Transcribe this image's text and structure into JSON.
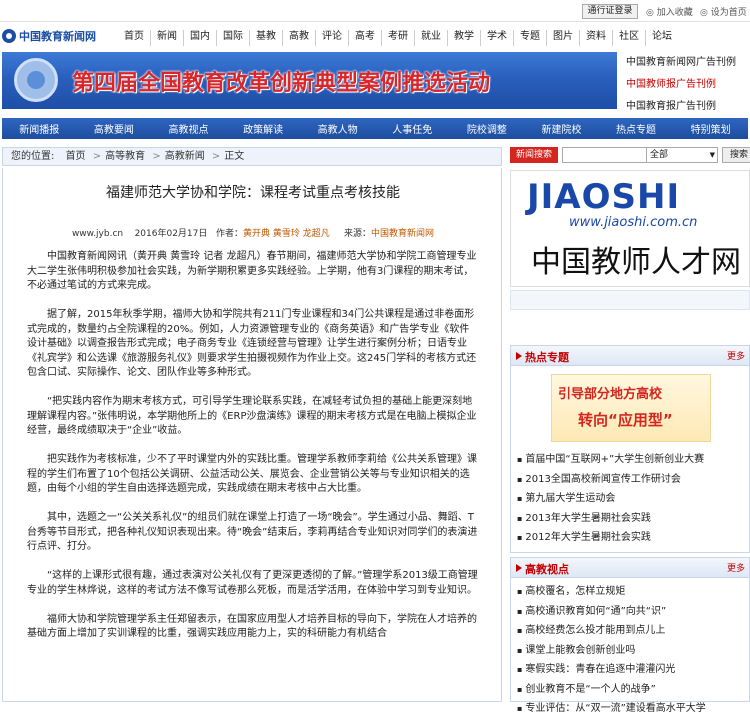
{
  "topbar": {
    "login": "通行证登录",
    "fav": "加入收藏",
    "home": "设为首页"
  },
  "logo": {
    "text": "中国教育新闻网"
  },
  "nav": [
    "首页",
    "新闻",
    "国内",
    "国际",
    "基教",
    "高教",
    "评论",
    "高考",
    "考研",
    "就业",
    "教学",
    "学术",
    "专题",
    "图片",
    "资料",
    "社区",
    "论坛"
  ],
  "banner": {
    "title": "第四届全国教育改革创新典型案例推选活动"
  },
  "adlinks": [
    "中国教育新闻网广告刊例",
    "中国教师报广告刊例",
    "中国教育报广告刊例"
  ],
  "subnav": [
    "新闻播报",
    "高教要闻",
    "高教视点",
    "政策解读",
    "高教人物",
    "人事任免",
    "院校调整",
    "新建院校",
    "热点专题",
    "特别策划"
  ],
  "breadcrumb": {
    "label": "您的位置:",
    "items": [
      "首页",
      "高等教育",
      "高教新闻",
      "正文"
    ]
  },
  "search": {
    "tag": "新闻搜索",
    "select": "全部",
    "button": "搜索"
  },
  "article": {
    "title": "福建师范大学协和学院：课程考试重点考核技能",
    "site": "www.jyb.cn",
    "date": "2016年02月17日",
    "author_label": "作者：",
    "author": "黄开典 黄雪玲 龙超凡",
    "source_label": "来源：",
    "source": "中国教育新闻网",
    "paragraphs": [
      "中国教育新闻网讯（黄开典 黄雪玲 记者 龙超凡）春节期间，福建师范大学协和学院工商管理专业大二学生张伟明积极参加社会实践，为新学期积累更多实践经验。上学期，他有3门课程的期末考试，不必通过笔试的方式来完成。",
      "据了解，2015年秋季学期，福师大协和学院共有211门专业课程和34门公共课程是通过非卷面形式完成的，数量约占全院课程的20%。例如，人力资源管理专业的《商务英语》和广告学专业《软件设计基础》以调查报告形式完成；电子商务专业《连锁经营与管理》让学生进行案例分析；日语专业《礼宾学》和公选课《旅游服务礼仪》则要求学生拍摄视频作为作业上交。这245门学科的考核方式还包含口试、实际操作、论文、团队作业等多种形式。",
      "“把实践内容作为期末考核方式，可引导学生理论联系实践，在减轻考试负担的基础上能更深刻地理解课程内容。”张伟明说，本学期他所上的《ERP沙盘演练》课程的期末考核方式是在电脑上模拟企业经营，最终成绩取决于“企业”收益。",
      "把实践作为考核标准，少不了平时课堂内外的实践比重。管理学系教师李莉给《公共关系管理》课程的学生们布置了10个包括公关调研、公益活动公关、展览会、企业营销公关等与专业知识相关的选题，由每个小组的学生自由选择选题完成，实践成绩在期末考核中占大比重。",
      "其中，选题之一“公关关系礼仪”的组员们就在课堂上打造了一场“晚会”。学生通过小品、舞蹈、T台秀等节目形式，把各种礼仪知识表现出来。待“晚会”结束后，李莉再结合专业知识对同学们的表演进行点评、打分。",
      "“这样的上课形式很有趣，通过表演对公关礼仪有了更深更透彻的了解。”管理学系2013级工商管理专业的学生林烨说，这样的考试方法不像写试卷那么死板，而是活学活用，在体验中学习到专业知识。",
      "福师大协和学院管理学系主任郑留表示，在国家应用型人才培养目标的导向下，学院在人才培养的基础方面上增加了实训课程的比重，强调实践应用能力上，实的科研能力有机结合"
    ]
  },
  "side_ad": {
    "brand": "JIAOSHI",
    "url": "www.jiaoshi.com.cn",
    "name": "中国教师人才网"
  },
  "hot": {
    "title": "热点专题",
    "more": "更多",
    "pic_line1": "引导部分地方高校",
    "pic_line2": "转向“应用型”",
    "items": [
      "首届中国“互联网+”大学生创新创业大赛",
      "2013全国高校新闻宣传工作研讨会",
      "第九届大学生运动会",
      "2013年大学生暑期社会实践",
      "2012年大学生暑期社会实践"
    ]
  },
  "view": {
    "title": "高教视点",
    "more": "更多",
    "items": [
      "高校覆名，怎样立规矩",
      "高校通识教育如何“通”向共“识”",
      "高校经费怎么投才能用到点儿上",
      "课堂上能教会创新创业吗",
      "寒假实践：青春在追逐中灌灌闪光",
      "创业教育不是“一个人的战争”",
      "专业评估：从“双一流”建设看高水平大学"
    ]
  }
}
